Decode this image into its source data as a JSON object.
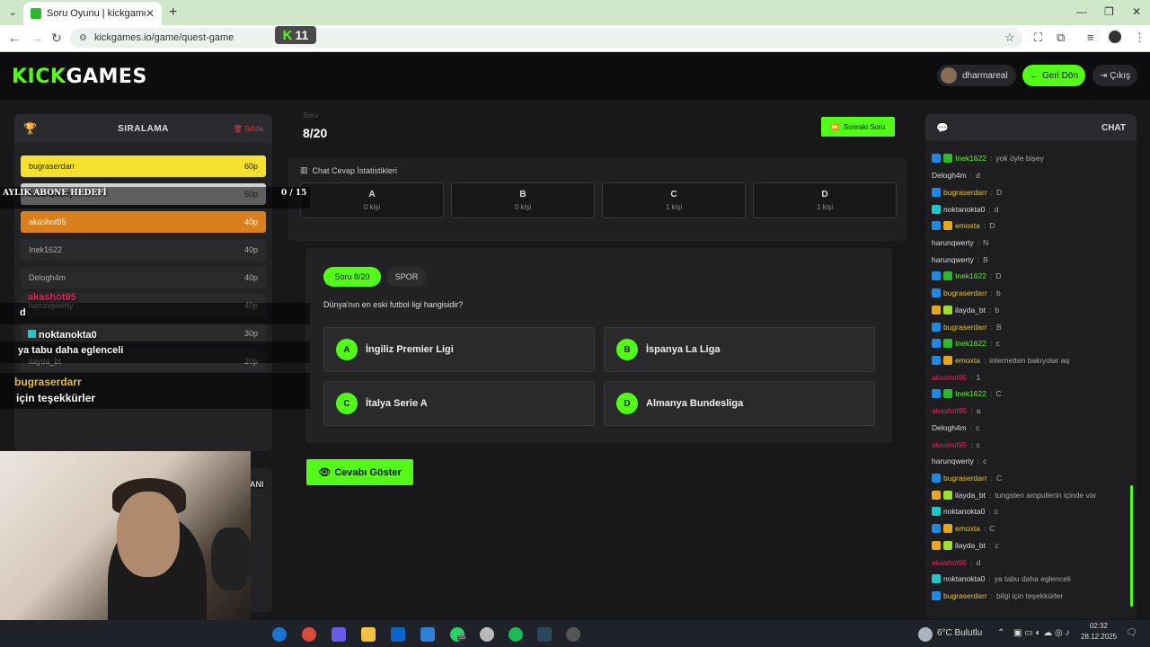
{
  "browser": {
    "tab_title": "Soru Oyunu | kickgames.io",
    "url": "kickgames.io/game/quest-game",
    "kick_badge": "11"
  },
  "header": {
    "logo_prefix": "KICK",
    "logo_suffix": "GAMES",
    "username": "dharmareal",
    "back_label": "Geri Dön",
    "exit_label": "Çıkış"
  },
  "leaderboard": {
    "title": "SIRALAMA",
    "reset_label": "Sıfırla",
    "rows": [
      {
        "name": "bugraserdarr",
        "points": "60p"
      },
      {
        "name": "harunqwerty",
        "points": "50p"
      },
      {
        "name": "akashot95",
        "points": "40p"
      },
      {
        "name": "Inek1622",
        "points": "40p"
      },
      {
        "name": "Delogh4m",
        "points": "40p"
      },
      {
        "name": "harunqwerty",
        "points": "40p"
      },
      {
        "name": "noktanokta0",
        "points": "30p"
      },
      {
        "name": "ilayda_bt",
        "points": "20p"
      }
    ]
  },
  "quiz": {
    "progress_label": "Soru",
    "progress": "8/20",
    "next_label": "Sonraki Soru",
    "stats_title": "Chat Cevap İstatistikleri",
    "stats": [
      {
        "letter": "A",
        "count": "0 kişi"
      },
      {
        "letter": "B",
        "count": "0 kişi"
      },
      {
        "letter": "C",
        "count": "1 kişi"
      },
      {
        "letter": "D",
        "count": "1 kişi"
      }
    ],
    "question_pill": "Soru 8/20",
    "category": "SPOR",
    "question": "Dünya'nın en eski futbol ligi hangisidir?",
    "options": [
      {
        "letter": "A",
        "text": "İngiliz Premier Ligi"
      },
      {
        "letter": "B",
        "text": "İspanya La Liga"
      },
      {
        "letter": "C",
        "text": "İtalya Serie A"
      },
      {
        "letter": "D",
        "text": "Almanya Bundesliga"
      }
    ],
    "show_answer_label": "Cevabı Göster"
  },
  "chat": {
    "title": "CHAT",
    "messages": [
      {
        "user": "Inek1622",
        "text": "yok öyle bişey",
        "color": "#53fc18",
        "badges": [
          "#1e88e5",
          "#2db82d"
        ]
      },
      {
        "user": "Delogh4m",
        "text": "d",
        "color": "#dddddd",
        "badges": []
      },
      {
        "user": "bugraserdarr",
        "text": "D",
        "color": "#e6c229",
        "badges": [
          "#1e88e5"
        ]
      },
      {
        "user": "noktanokta0",
        "text": "d",
        "color": "#dddddd",
        "badges": [
          "#1ec8c8"
        ]
      },
      {
        "user": "emoxta",
        "text": "D",
        "color": "#e6c229",
        "badges": [
          "#1e88e5",
          "#e6a71e"
        ]
      },
      {
        "user": "harunqwerty",
        "text": "N",
        "color": "#dddddd",
        "badges": []
      },
      {
        "user": "harunqwerty",
        "text": "B",
        "color": "#dddddd",
        "badges": []
      },
      {
        "user": "Inek1622",
        "text": "D",
        "color": "#53fc18",
        "badges": [
          "#1e88e5",
          "#2db82d"
        ]
      },
      {
        "user": "bugraserdarr",
        "text": "b",
        "color": "#e6c229",
        "badges": [
          "#1e88e5"
        ]
      },
      {
        "user": "ilayda_bt",
        "text": "b",
        "color": "#dddddd",
        "badges": [
          "#e6a71e",
          "#9be02e"
        ]
      },
      {
        "user": "bugraserdarr",
        "text": "B",
        "color": "#e6c229",
        "badges": [
          "#1e88e5"
        ]
      },
      {
        "user": "Inek1622",
        "text": "c",
        "color": "#53fc18",
        "badges": [
          "#1e88e5",
          "#2db82d"
        ]
      },
      {
        "user": "emoxta",
        "text": "internetten bakıyolar aq",
        "color": "#e6c229",
        "badges": [
          "#1e88e5",
          "#e6a71e"
        ]
      },
      {
        "user": "akashot95",
        "text": "1",
        "color": "#e0245e",
        "badges": []
      },
      {
        "user": "Inek1622",
        "text": "C",
        "color": "#53fc18",
        "badges": [
          "#1e88e5",
          "#2db82d"
        ]
      },
      {
        "user": "akashot95",
        "text": "a",
        "color": "#e0245e",
        "badges": []
      },
      {
        "user": "Delogh4m",
        "text": "c",
        "color": "#dddddd",
        "badges": []
      },
      {
        "user": "akashot95",
        "text": "c",
        "color": "#e0245e",
        "badges": []
      },
      {
        "user": "harunqwerty",
        "text": "c",
        "color": "#dddddd",
        "badges": []
      },
      {
        "user": "bugraserdarr",
        "text": "C",
        "color": "#e6c229",
        "badges": [
          "#1e88e5"
        ]
      },
      {
        "user": "ilayda_bt",
        "text": "tungsten ampullerin içinde var",
        "color": "#dddddd",
        "badges": [
          "#e6a71e",
          "#9be02e"
        ]
      },
      {
        "user": "noktanokta0",
        "text": "c",
        "color": "#dddddd",
        "badges": [
          "#1ec8c8"
        ]
      },
      {
        "user": "emoxta",
        "text": "C",
        "color": "#e6c229",
        "badges": [
          "#1e88e5",
          "#e6a71e"
        ]
      },
      {
        "user": "ilayda_bt",
        "text": "c",
        "color": "#dddddd",
        "badges": [
          "#e6a71e",
          "#9be02e"
        ]
      },
      {
        "user": "akashot95",
        "text": "d",
        "color": "#e0245e",
        "badges": []
      },
      {
        "user": "noktanokta0",
        "text": "ya tabu daha eglenceli",
        "color": "#dddddd",
        "badges": [
          "#1ec8c8"
        ]
      },
      {
        "user": "bugraserdarr",
        "text": "bilgi için teşekkürler",
        "color": "#e6c229",
        "badges": [
          "#1e88e5"
        ]
      }
    ]
  },
  "overlay": {
    "goal_label": "AYLIK ABONE HEDEFİ",
    "goal_count": "0 / 15",
    "lines": [
      {
        "user": "akashot95",
        "text": "d"
      },
      {
        "user": "noktanokta0",
        "text": "ya tabu daha eglenceli"
      },
      {
        "user": "bugraserdarr",
        "text": "için teşekkürler"
      }
    ],
    "partial_label": "ANI"
  },
  "taskbar": {
    "weather": "6°C Bulutlu",
    "time": "02:32",
    "date": "28.12.2025",
    "whatsapp_badge": "55"
  },
  "colors": {
    "accent": "#53fc18",
    "gold": "#f4e12e",
    "silver": "#d2d2d2",
    "bronze": "#d97f1e"
  }
}
